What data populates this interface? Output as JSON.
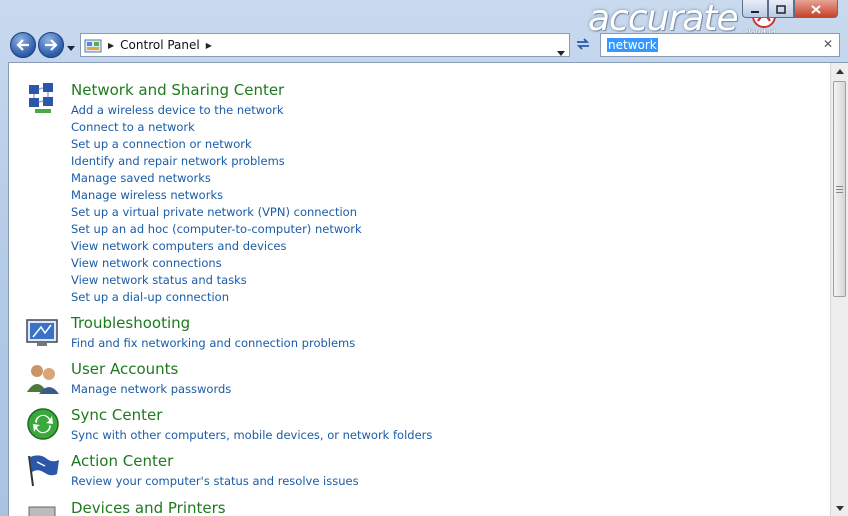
{
  "window": {
    "logo_text": "accurate",
    "logo_sub": "cloud.id",
    "controls": [
      "minimize-icon",
      "maximize-icon",
      "close-icon"
    ]
  },
  "nav": {
    "address_label": "Control Panel",
    "search_value": "network"
  },
  "sections": [
    {
      "title": "Network and Sharing Center",
      "icon": "network-sharing-icon",
      "links": [
        "Add a wireless device to the network",
        "Connect to a network",
        "Set up a connection or network",
        "Identify and repair network problems",
        "Manage saved networks",
        "Manage wireless networks",
        "Set up a virtual private network (VPN) connection",
        "Set up an ad hoc (computer-to-computer) network",
        "View network computers and devices",
        "View network connections",
        "View network status and tasks",
        "Set up a dial-up connection"
      ]
    },
    {
      "title": "Troubleshooting",
      "icon": "troubleshooting-icon",
      "links": [
        "Find and fix networking and connection problems"
      ]
    },
    {
      "title": "User Accounts",
      "icon": "user-accounts-icon",
      "links": [
        "Manage network passwords"
      ]
    },
    {
      "title": "Sync Center",
      "icon": "sync-center-icon",
      "links": [
        "Sync with other computers, mobile devices, or network folders"
      ]
    },
    {
      "title": "Action Center",
      "icon": "action-center-flag-icon",
      "links": [
        "Review your computer's status and resolve issues"
      ]
    },
    {
      "title": "Devices and Printers",
      "icon": "devices-printers-icon",
      "links": []
    }
  ]
}
